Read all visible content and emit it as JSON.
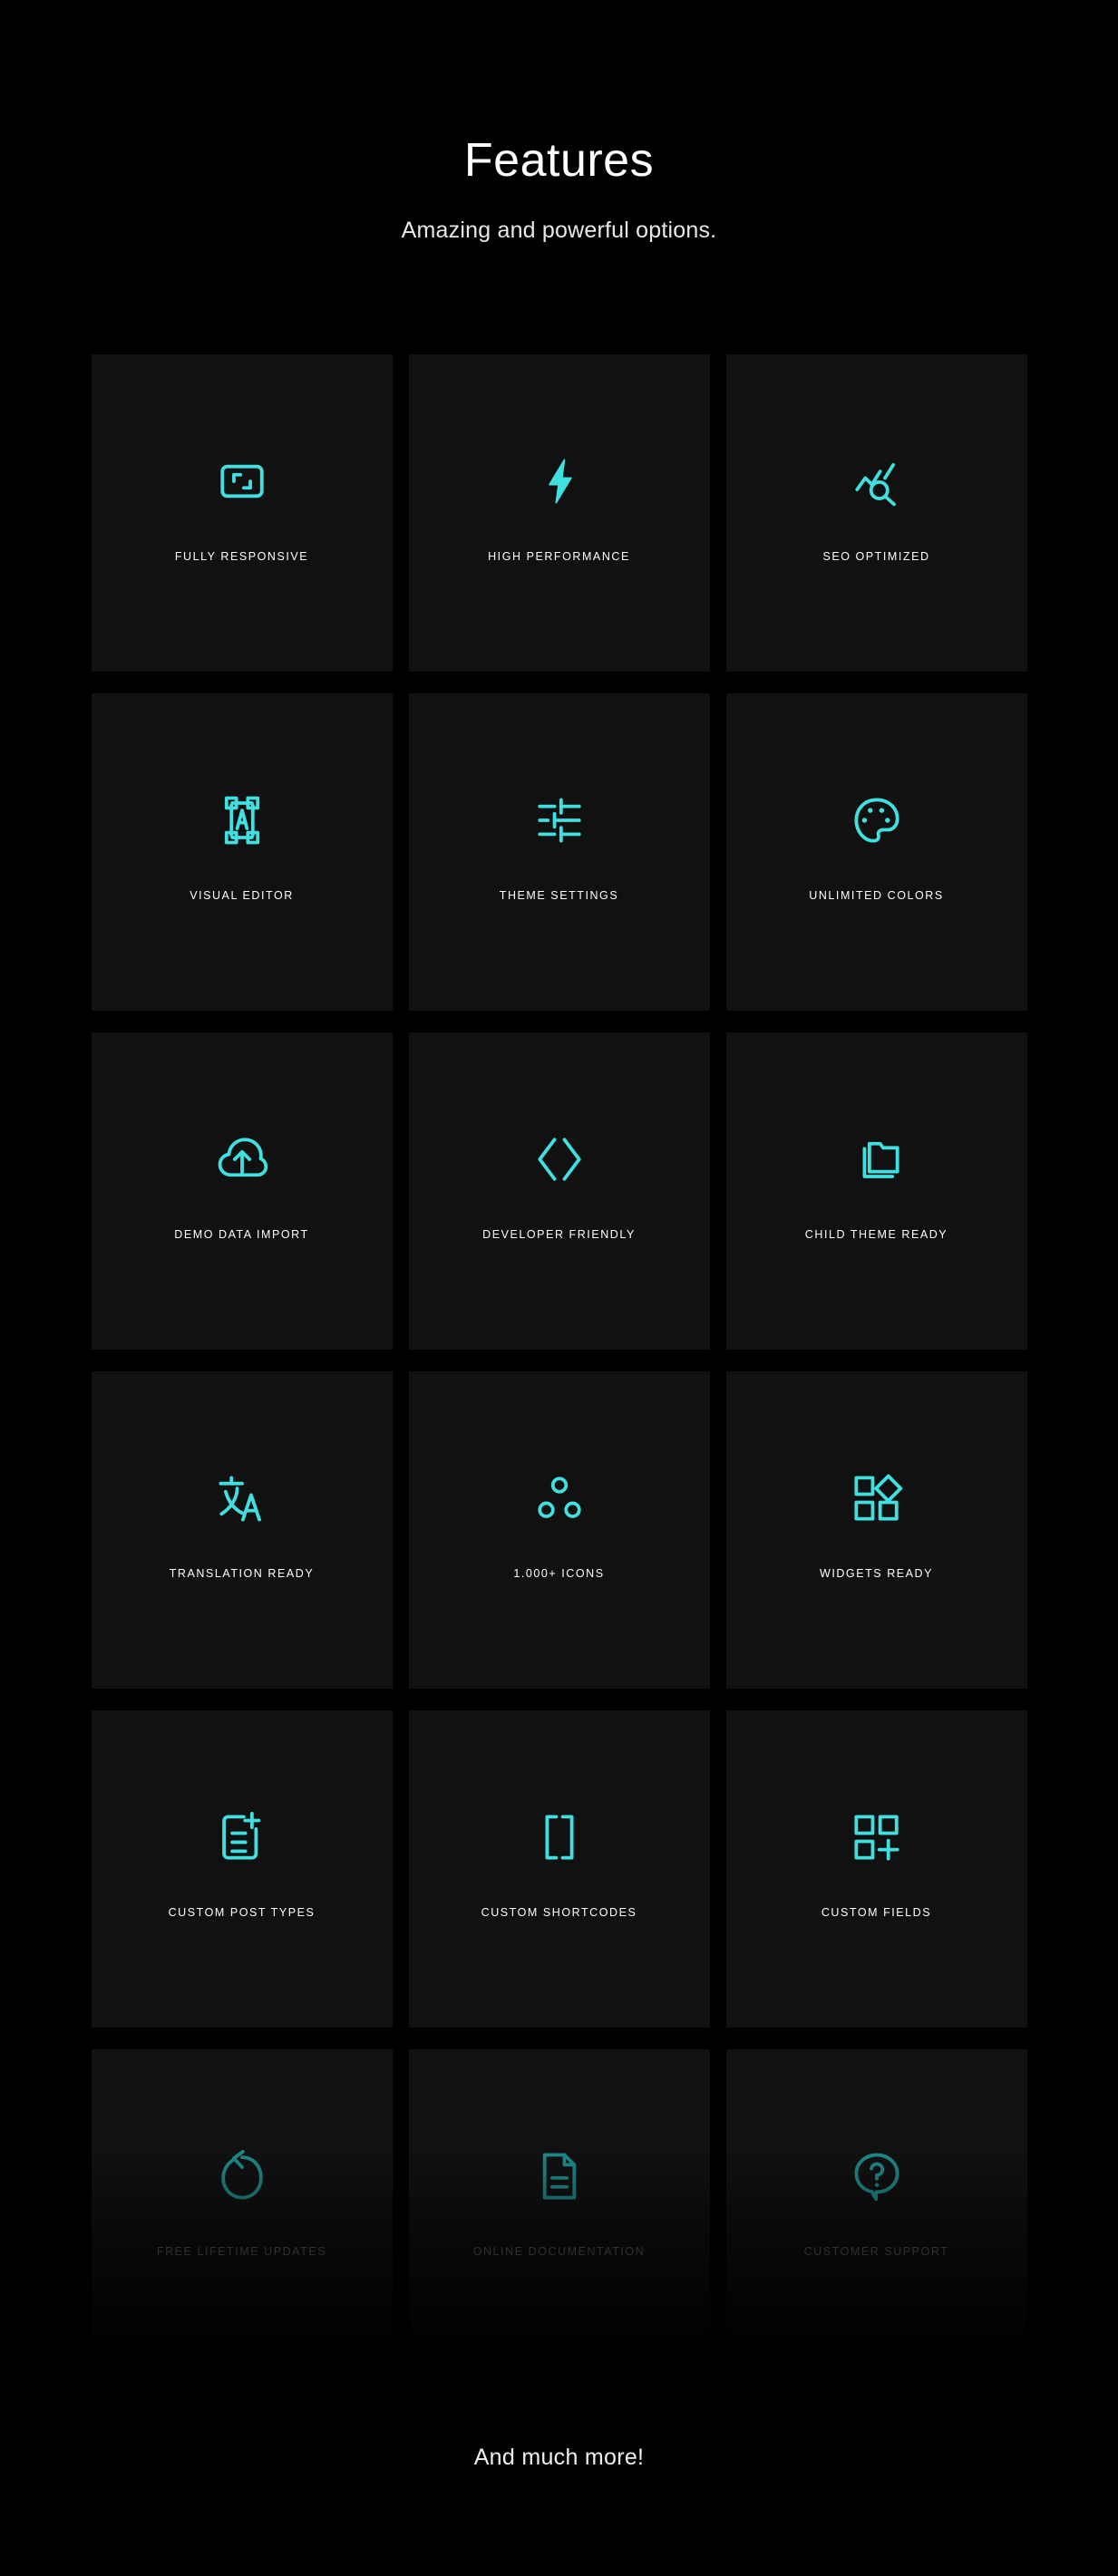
{
  "header": {
    "title": "Features",
    "subtitle": "Amazing and powerful options."
  },
  "theme": {
    "background": "#000000",
    "card_background": "#111111",
    "accent": "#3FE0DF",
    "accent_dimmed": "#1F8A8A",
    "label_color": "#FFFFFF",
    "label_color_dimmed": "#6A6A6A"
  },
  "features": [
    {
      "label": "FULLY RESPONSIVE",
      "icon": "responsive-frame-icon",
      "dimmed": false
    },
    {
      "label": "HIGH PERFORMANCE",
      "icon": "lightning-bolt-icon",
      "dimmed": false
    },
    {
      "label": "SEO OPTIMIZED",
      "icon": "chart-search-icon",
      "dimmed": false
    },
    {
      "label": "VISUAL EDITOR",
      "icon": "text-selection-icon",
      "dimmed": false
    },
    {
      "label": "THEME SETTINGS",
      "icon": "sliders-icon",
      "dimmed": false
    },
    {
      "label": "UNLIMITED COLORS",
      "icon": "palette-icon",
      "dimmed": false
    },
    {
      "label": "DEMO DATA IMPORT",
      "icon": "cloud-upload-icon",
      "dimmed": false
    },
    {
      "label": "DEVELOPER FRIENDLY",
      "icon": "code-brackets-icon",
      "dimmed": false
    },
    {
      "label": "CHILD THEME READY",
      "icon": "folder-stack-icon",
      "dimmed": false
    },
    {
      "label": "TRANSLATION READY",
      "icon": "translate-icon",
      "dimmed": false
    },
    {
      "label": "1.000+ ICONS",
      "icon": "three-circles-icon",
      "dimmed": false
    },
    {
      "label": "WIDGETS READY",
      "icon": "shapes-grid-icon",
      "dimmed": false
    },
    {
      "label": "CUSTOM POST TYPES",
      "icon": "document-plus-icon",
      "dimmed": false
    },
    {
      "label": "CUSTOM SHORTCODES",
      "icon": "square-brackets-icon",
      "dimmed": false
    },
    {
      "label": "CUSTOM FIELDS",
      "icon": "grid-plus-icon",
      "dimmed": false
    },
    {
      "label": "FREE LIFETIME UPDATES",
      "icon": "refresh-arrow-icon",
      "dimmed": true
    },
    {
      "label": "ONLINE DOCUMENTATION",
      "icon": "file-lines-icon",
      "dimmed": true
    },
    {
      "label": "CUSTOMER SUPPORT",
      "icon": "question-bubble-icon",
      "dimmed": true
    }
  ],
  "footer": {
    "text": "And much more!"
  }
}
